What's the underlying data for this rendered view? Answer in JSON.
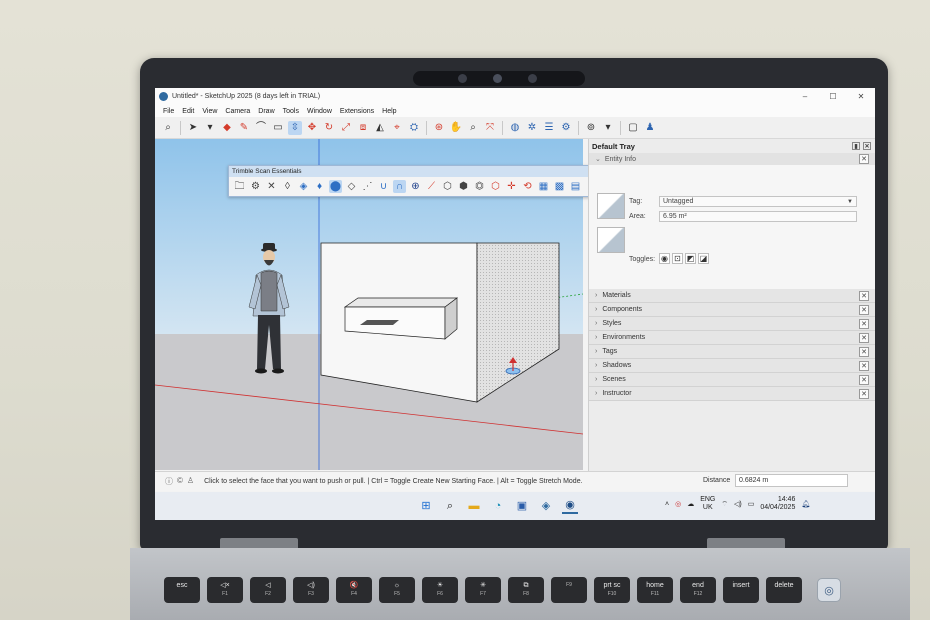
{
  "window": {
    "title": "Untitled* - SketchUp 2025 (8 days left in TRIAL)",
    "controls": [
      "–",
      "☐",
      "✕"
    ]
  },
  "menu": [
    "File",
    "Edit",
    "View",
    "Camera",
    "Draw",
    "Tools",
    "Window",
    "Extensions",
    "Help"
  ],
  "floating_toolbar": {
    "title": "Trimble Scan Essentials",
    "close": "✕"
  },
  "tray": {
    "title": "Default Tray",
    "entity_info": {
      "header": "Entity Info",
      "tag_label": "Tag:",
      "tag_value": "Untagged",
      "area_label": "Area:",
      "area_value": "6.95 m²",
      "toggles_label": "Toggles:"
    },
    "panels": [
      "Materials",
      "Components",
      "Styles",
      "Environments",
      "Tags",
      "Shadows",
      "Scenes",
      "Instructor"
    ]
  },
  "status": {
    "hint": "Click to select the face that you want to push or pull.  |  Ctrl = Toggle Create New Starting Face.  |  Alt = Toggle Stretch Mode.",
    "distance_label": "Distance",
    "distance_value": "0.6824 m"
  },
  "taskbar": {
    "lang_top": "ENG",
    "lang_bottom": "UK",
    "time": "14:46",
    "date": "04/04/2025"
  },
  "keyboard": {
    "row1": [
      {
        "label": "esc",
        "sub": ""
      },
      {
        "label": "◁×",
        "sub": "F1"
      },
      {
        "label": "◁",
        "sub": "F2"
      },
      {
        "label": "◁)",
        "sub": "F3"
      },
      {
        "label": "🔇",
        "sub": "F4"
      },
      {
        "label": "☼",
        "sub": "F5"
      },
      {
        "label": "☀",
        "sub": "F6"
      },
      {
        "label": "✳",
        "sub": "F7"
      },
      {
        "label": "⧉",
        "sub": "F8"
      },
      {
        "label": "",
        "sub": "F9"
      },
      {
        "label": "prt sc",
        "sub": "F10"
      },
      {
        "label": "home",
        "sub": "F11"
      },
      {
        "label": "end",
        "sub": "F12"
      },
      {
        "label": "insert",
        "sub": ""
      },
      {
        "label": "delete",
        "sub": ""
      }
    ]
  }
}
